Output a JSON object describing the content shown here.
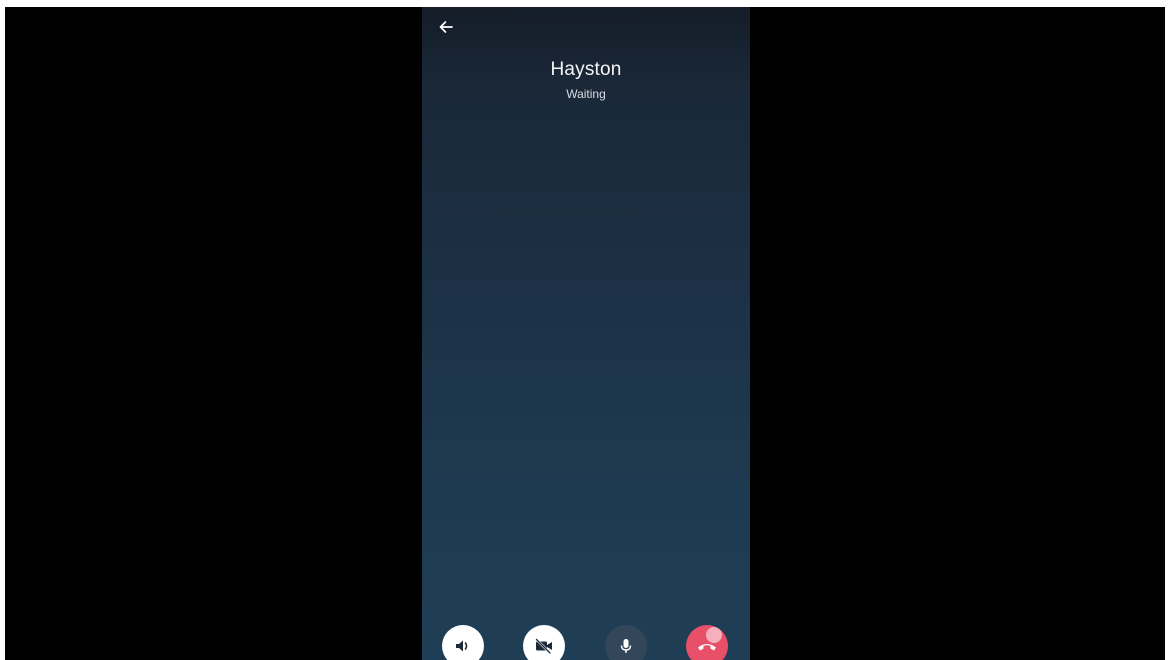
{
  "call": {
    "caller_name": "Hayston",
    "status": "Waiting"
  },
  "icons": {
    "back": "arrow-left-icon",
    "speaker": "speaker-icon",
    "video": "video-off-icon",
    "mic": "microphone-icon",
    "end": "end-call-icon"
  },
  "colors": {
    "background_top": "#141d28",
    "background_bottom": "#1f3e55",
    "end_call": "#e8506a",
    "mic_button": "#34475a",
    "control_light": "#ffffff"
  }
}
